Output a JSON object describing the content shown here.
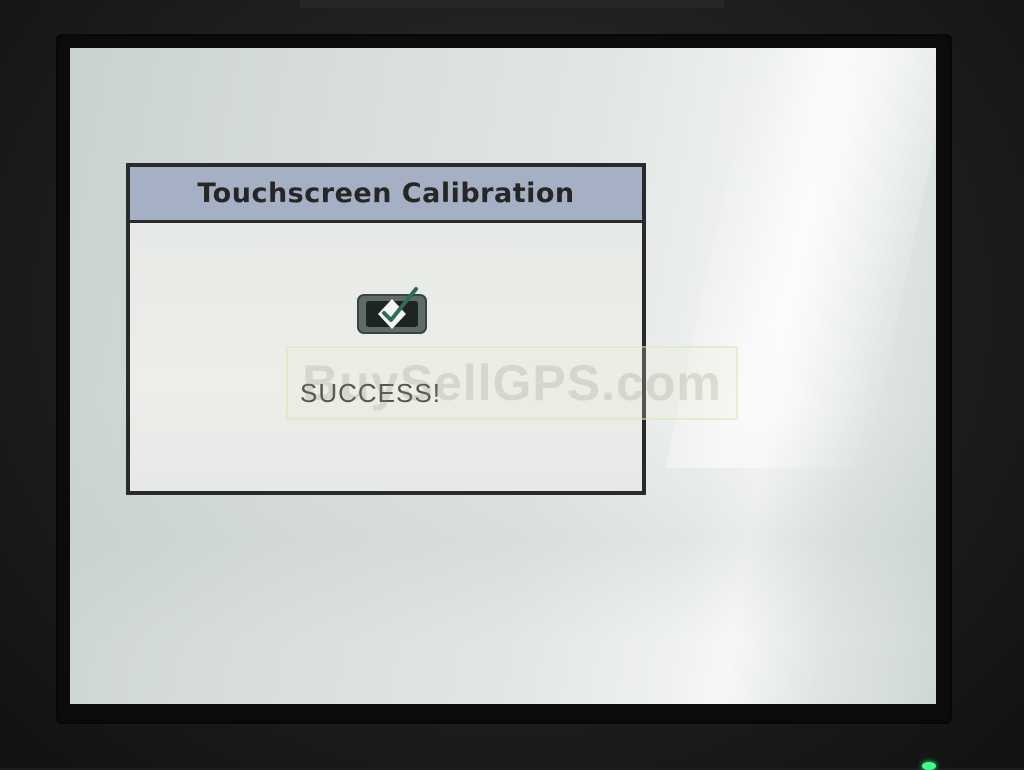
{
  "dialog": {
    "title": "Touchscreen Calibration",
    "message": "SUCCESS!",
    "icon": "checkmark-success-icon"
  },
  "watermark": {
    "text": "BuySellGPS.com"
  },
  "colors": {
    "titlebar": "#a6b0c4",
    "dialog_border": "#2a2a2e",
    "dialog_body": "#e8ebe7",
    "checkmark": "#2e6b5e",
    "power_led": "#3dff8a"
  }
}
